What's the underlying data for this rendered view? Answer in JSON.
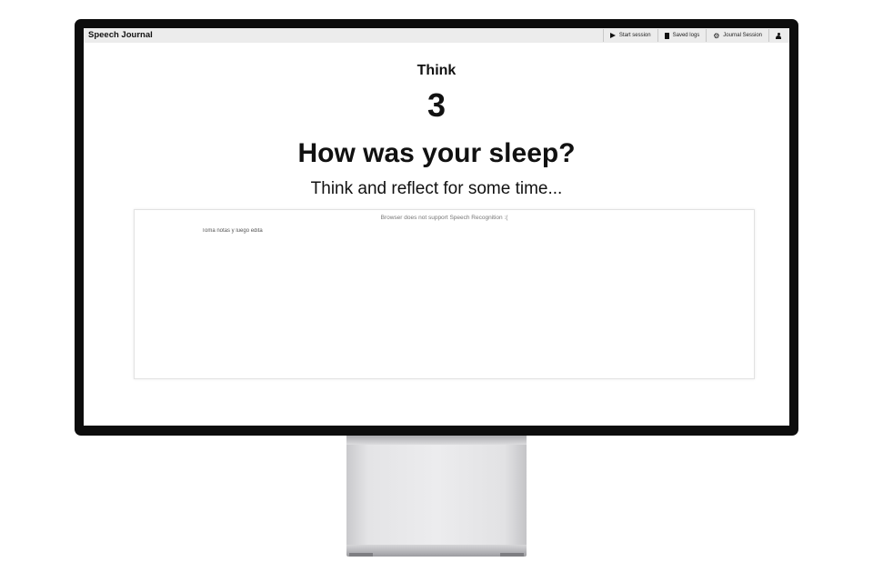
{
  "app": {
    "brand": "Speech Journal"
  },
  "nav": {
    "items": [
      {
        "label": "Start session",
        "icon": "play-icon"
      },
      {
        "label": "Saved logs",
        "icon": "document-icon"
      },
      {
        "label": "Journal Session",
        "icon": "gear-icon"
      }
    ],
    "profile_icon": "user-icon"
  },
  "main": {
    "mode": "Think",
    "counter": "3",
    "question": "How was your sleep?",
    "subtitle": "Think and reflect for some time..."
  },
  "notes": {
    "support_message": "Browser does not support Speech Recognition :(",
    "placeholder": "Toma notas y luego edita"
  },
  "colors": {
    "monitor_bezel": "#0d0d0d",
    "topbar_bg": "#ececec",
    "text": "#111111"
  }
}
